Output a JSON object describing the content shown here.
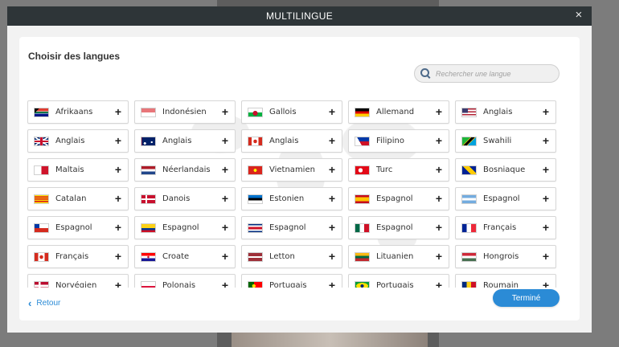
{
  "window": {
    "title": "MULTILINGUE",
    "close_label": "×"
  },
  "panel": {
    "title": "Choisir des langues",
    "search": {
      "placeholder": "Rechercher une langue",
      "value": ""
    }
  },
  "languages": [
    {
      "label": "Afrikaans",
      "flag": "za"
    },
    {
      "label": "Indonésien",
      "flag": "id"
    },
    {
      "label": "Gallois",
      "flag": "wales"
    },
    {
      "label": "Allemand",
      "flag": "de"
    },
    {
      "label": "Anglais",
      "flag": "us"
    },
    {
      "label": "Anglais",
      "flag": "gb"
    },
    {
      "label": "Anglais",
      "flag": "au"
    },
    {
      "label": "Anglais",
      "flag": "ca"
    },
    {
      "label": "Filipino",
      "flag": "ph"
    },
    {
      "label": "Swahili",
      "flag": "tz"
    },
    {
      "label": "Maltais",
      "flag": "mt"
    },
    {
      "label": "Néerlandais",
      "flag": "nl"
    },
    {
      "label": "Vietnamien",
      "flag": "vn"
    },
    {
      "label": "Turc",
      "flag": "tr"
    },
    {
      "label": "Bosniaque",
      "flag": "ba"
    },
    {
      "label": "Catalan",
      "flag": "cat"
    },
    {
      "label": "Danois",
      "flag": "dk"
    },
    {
      "label": "Estonien",
      "flag": "ee"
    },
    {
      "label": "Espagnol",
      "flag": "es"
    },
    {
      "label": "Espagnol",
      "flag": "ar"
    },
    {
      "label": "Espagnol",
      "flag": "cl"
    },
    {
      "label": "Espagnol",
      "flag": "co"
    },
    {
      "label": "Espagnol",
      "flag": "cr"
    },
    {
      "label": "Espagnol",
      "flag": "mx"
    },
    {
      "label": "Français",
      "flag": "fr"
    },
    {
      "label": "Français",
      "flag": "ca"
    },
    {
      "label": "Croate",
      "flag": "hr"
    },
    {
      "label": "Letton",
      "flag": "lv"
    },
    {
      "label": "Lituanien",
      "flag": "lt"
    },
    {
      "label": "Hongrois",
      "flag": "hu"
    },
    {
      "label": "Norvégien",
      "flag": "no"
    },
    {
      "label": "Polonais",
      "flag": "pl"
    },
    {
      "label": "Portugais",
      "flag": "pt"
    },
    {
      "label": "Portugais",
      "flag": "br"
    },
    {
      "label": "Roumain",
      "flag": "ro"
    }
  ],
  "add_icon": "plus-icon",
  "footer": {
    "back_label": "Retour",
    "done_label": "Terminé"
  },
  "colors": {
    "accent": "#2b8bd6",
    "titlebar": "#2e3538"
  }
}
